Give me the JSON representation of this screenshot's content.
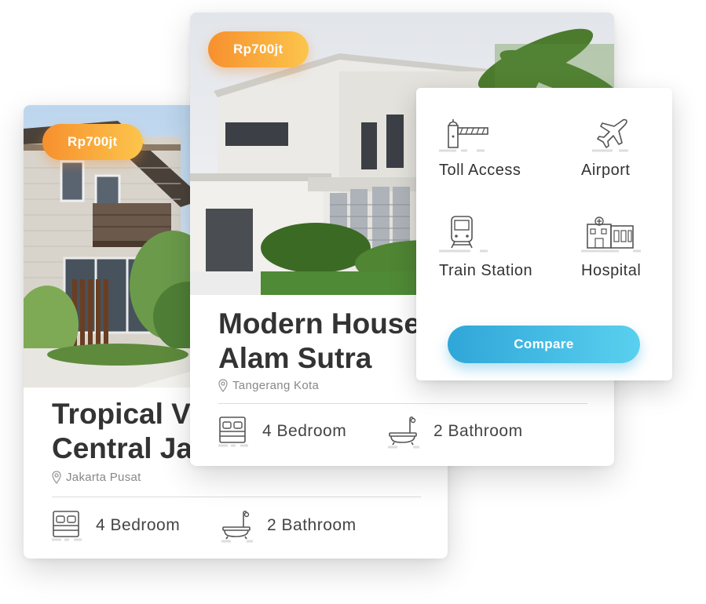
{
  "listings": [
    {
      "price": "Rp700jt",
      "title": "Tropical Villa\nCentral Jakarta",
      "location": "Jakarta Pusat",
      "bedroom": "4 Bedroom",
      "bathroom": "2 Bathroom"
    },
    {
      "price": "Rp700jt",
      "title": "Modern House\nAlam Sutra",
      "location": "Tangerang Kota",
      "bedroom": "4 Bedroom",
      "bathroom": "2 Bathroom"
    }
  ],
  "amenities": {
    "items": [
      {
        "label": "Toll Access",
        "icon": "toll-gate-icon"
      },
      {
        "label": "Airport",
        "icon": "airplane-icon"
      },
      {
        "label": "Train Station",
        "icon": "train-icon"
      },
      {
        "label": "Hospital",
        "icon": "hospital-icon"
      }
    ],
    "compare_label": "Compare"
  },
  "colors": {
    "price_gradient": [
      "#f7902e",
      "#fcc54b"
    ],
    "button_gradient": [
      "#2fa6d8",
      "#5ad0ef"
    ],
    "title": "#333333",
    "muted": "#888888"
  }
}
